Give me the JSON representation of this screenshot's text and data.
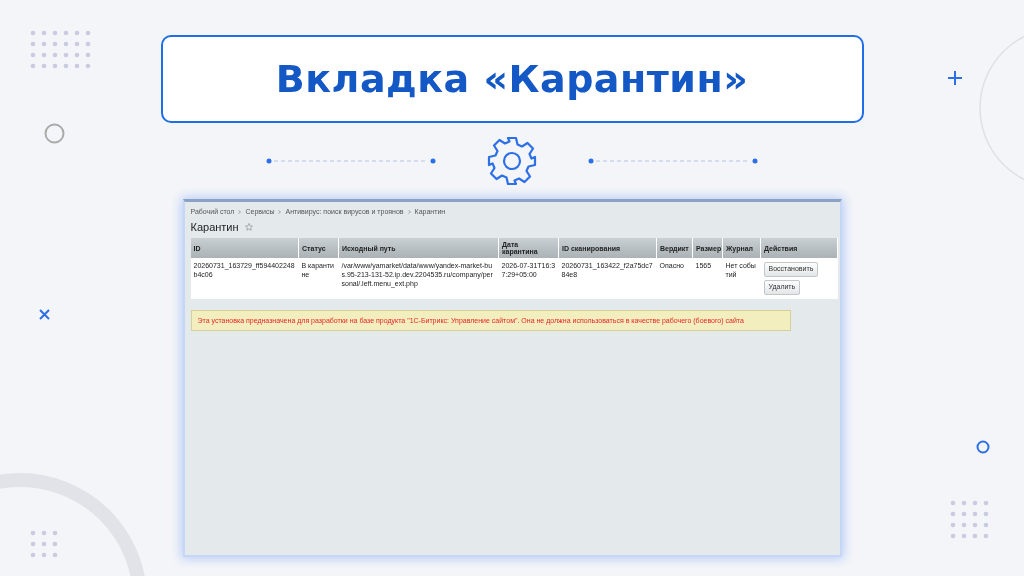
{
  "slide": {
    "title": "Вкладка «Карантин»"
  },
  "screen": {
    "breadcrumbs": [
      "Рабочий стол",
      "Сервисы",
      "Антивирус: поиск вирусов и троянов",
      "Карантин"
    ],
    "page_title": "Карантин",
    "table": {
      "columns": [
        "ID",
        "Статус",
        "Исходный путь",
        "Дата карантина",
        "ID сканирования",
        "Вердикт",
        "Размер",
        "Журнал",
        "Действия"
      ],
      "rows": [
        {
          "cells": [
            "20260731_163729_ff594402248b4c06",
            "В карантине",
            "/var/www/yamarket/data/www/yandex-market-bus.95-213-131-52.ip.dev.2204535.ru/company/personal/.left.menu_ext.php",
            "2026-07-31T16:37:29+05:00",
            "20260731_163422_f2a75dc784e8",
            "Опасно",
            "1565",
            "Нет событий"
          ],
          "actions": [
            "Восстановить",
            "Удалить"
          ]
        }
      ]
    },
    "notice": "Эта установка предназначена для разработки на базе продукта \"1С-Битрикс: Управление сайтом\". Она не должна использоваться в качестве рабочего (боевого) сайта"
  }
}
